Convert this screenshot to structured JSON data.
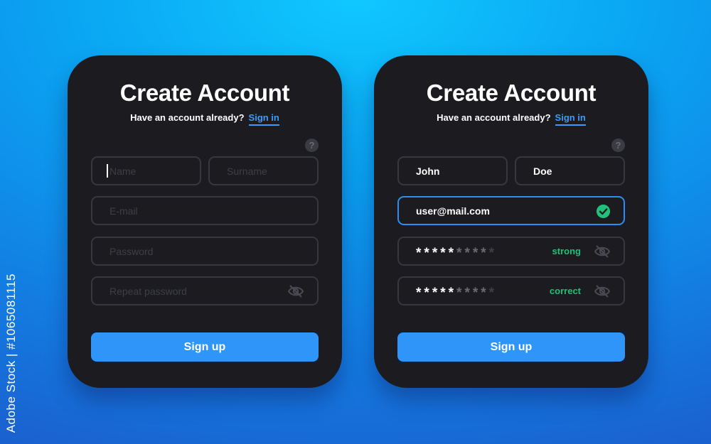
{
  "side_id": "Adobe Stock | #1065081115",
  "colors": {
    "accent": "#2f95f9",
    "success": "#22c07a",
    "card": "#1c1c20"
  },
  "cards": [
    {
      "title": "Create Account",
      "subtitle": "Have an account already?",
      "sign_in": "Sign in",
      "help": "?",
      "fields": {
        "name": {
          "value": "",
          "placeholder": "Name"
        },
        "surname": {
          "value": "",
          "placeholder": "Surname"
        },
        "email": {
          "value": "",
          "placeholder": "E-mail"
        },
        "password": {
          "value": "",
          "placeholder": "Password"
        },
        "repeat_password": {
          "value": "",
          "placeholder": "Repeat password"
        }
      },
      "button": "Sign up"
    },
    {
      "title": "Create Account",
      "subtitle": "Have an account already?",
      "sign_in": "Sign in",
      "help": "?",
      "fields": {
        "name": {
          "value": "John"
        },
        "surname": {
          "value": "Doe"
        },
        "email": {
          "value": "user@mail.com"
        },
        "password": {
          "strength": "strong"
        },
        "repeat_password": {
          "status": "correct"
        }
      },
      "button": "Sign up"
    }
  ]
}
